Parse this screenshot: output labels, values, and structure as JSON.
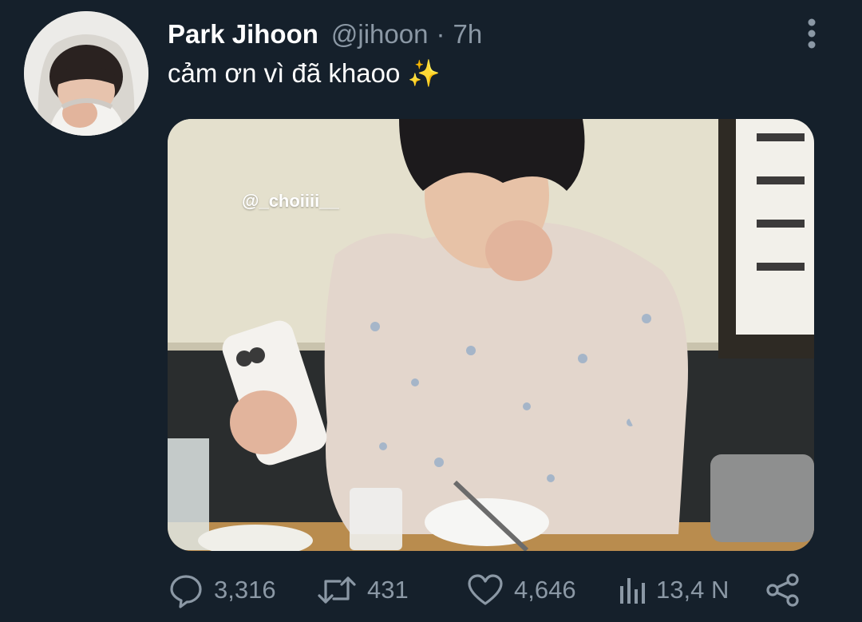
{
  "tweet": {
    "author_name": "Park Jihoon",
    "handle": "@jihoon",
    "separator": "·",
    "time": "7h",
    "text": "cảm ơn vì đã khaoo ✨",
    "media_watermark": "@_choiiii__"
  },
  "actions": {
    "reply_count": "3,316",
    "retweet_count": "431",
    "like_count": "4,646",
    "views_count": "13,4 N"
  },
  "icons": {
    "reply": "reply-icon",
    "retweet": "retweet-icon",
    "like": "heart-icon",
    "views": "views-icon",
    "share": "share-icon",
    "more": "more-icon"
  },
  "colors": {
    "background": "#15202b",
    "text_primary": "#ffffff",
    "text_secondary": "#8b98a5"
  }
}
